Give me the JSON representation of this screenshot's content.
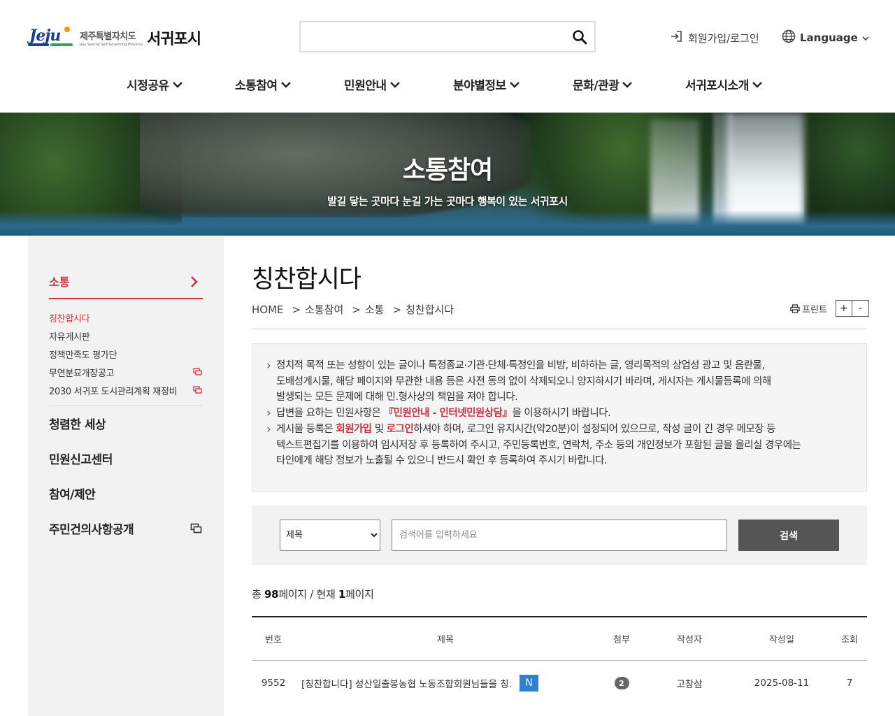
{
  "header": {
    "logo": {
      "wordmark": "Jeju",
      "province": "제주특별자치도",
      "province_en": "Jeju Special Self-Governing Province",
      "city": "서귀포시"
    },
    "search": {
      "value": "",
      "placeholder": ""
    },
    "login_label": "회원가입/로그인",
    "language_label": "Language",
    "nav": [
      {
        "label": "시정공유"
      },
      {
        "label": "소통참여"
      },
      {
        "label": "민원안내"
      },
      {
        "label": "분야별정보"
      },
      {
        "label": "문화/관광"
      },
      {
        "label": "서귀포시소개"
      }
    ]
  },
  "hero": {
    "title": "소통참여",
    "subtitle": "발길 닿는 곳마다 눈길 가는 곳마다 행복이 있는 서귀포시"
  },
  "sidebar": {
    "section": "소통",
    "sub_items": [
      {
        "label": "칭찬합시다",
        "active": true,
        "external": false
      },
      {
        "label": "자유게시판",
        "active": false,
        "external": false
      },
      {
        "label": "정책만족도 평가단",
        "active": false,
        "external": false
      },
      {
        "label": "무연분묘개장공고",
        "active": false,
        "external": true
      },
      {
        "label": "2030 서귀포 도시관리계획 재정비",
        "active": false,
        "external": true
      }
    ],
    "main_items": [
      {
        "label": "청렴한 세상",
        "external": false
      },
      {
        "label": "민원신고센터",
        "external": false
      },
      {
        "label": "참여/제안",
        "external": false
      },
      {
        "label": "주민건의사항공개",
        "external": true
      }
    ]
  },
  "content": {
    "title": "칭찬합시다",
    "breadcrumb": [
      "HOME",
      "소통참여",
      "소통",
      "칭찬합시다"
    ],
    "print_label": "프린트",
    "zoom_in": "+",
    "zoom_out": "-",
    "notice": {
      "item1": {
        "line1": "정치적 목적 또는 성향이 있는 글이나 특정종교·기관·단체·특정인을 비방, 비하하는 글, 영리목적의 상업성 광고 및 음란물,",
        "line2": "도배성게시물, 해당 페이지와 무관한 내용 등은 사전 동의 없이 삭제되오니 양지하시기 바라며, 게시자는 게시물등록에 의해",
        "line3": "발생되는 모든 문제에 대해 민.형사상의 책임을 져야 합니다."
      },
      "item2": {
        "before": "답변을 요하는 민원사항은 ",
        "link": "『민원안내 - 인터넷민원상담』",
        "after": "을 이용하시기 바랍니다."
      },
      "item3": {
        "before": "게시물 등록은 ",
        "join": "회원가입",
        "mid": " 및 ",
        "login": "로그인",
        "after": "하셔야 하며, 로그인 유지시간(약20분)이 설정되어 있으므로, 작성 글이 긴 경우 메모장 등",
        "line2": "텍스트편집기를 이용하여 임시저장 후 등록하여 주시고, 주민등록번호, 연락처, 주소 등의 개인정보가 포함된 글을 올리실 경우에는",
        "line3": "타인에게 해당 정보가 노출될 수 있으니 반드시 확인 후 등록하여 주시기 바랍니다."
      }
    },
    "filter": {
      "select_value": "제목",
      "input_value": "",
      "input_placeholder": "검색어를 입력하세요",
      "button_label": "검색"
    },
    "page_info": {
      "prefix": "총 ",
      "total": "98",
      "mid": "페이지 / 현재 ",
      "current": "1",
      "suffix": "페이지"
    },
    "table": {
      "headers": [
        "번호",
        "제목",
        "첨부",
        "작성자",
        "작성일",
        "조회"
      ],
      "rows": [
        {
          "no": "9552",
          "title": "[칭찬합니다] 성산일출봉농협 노동조합회원님들을 칭..",
          "badge": "N",
          "attachments": "2",
          "author": "고창삼",
          "date": "2025-08-11",
          "views": "7"
        }
      ]
    }
  },
  "colors": {
    "accent": "#c8333f",
    "new_badge": "#2f80d1",
    "button": "#555555"
  }
}
